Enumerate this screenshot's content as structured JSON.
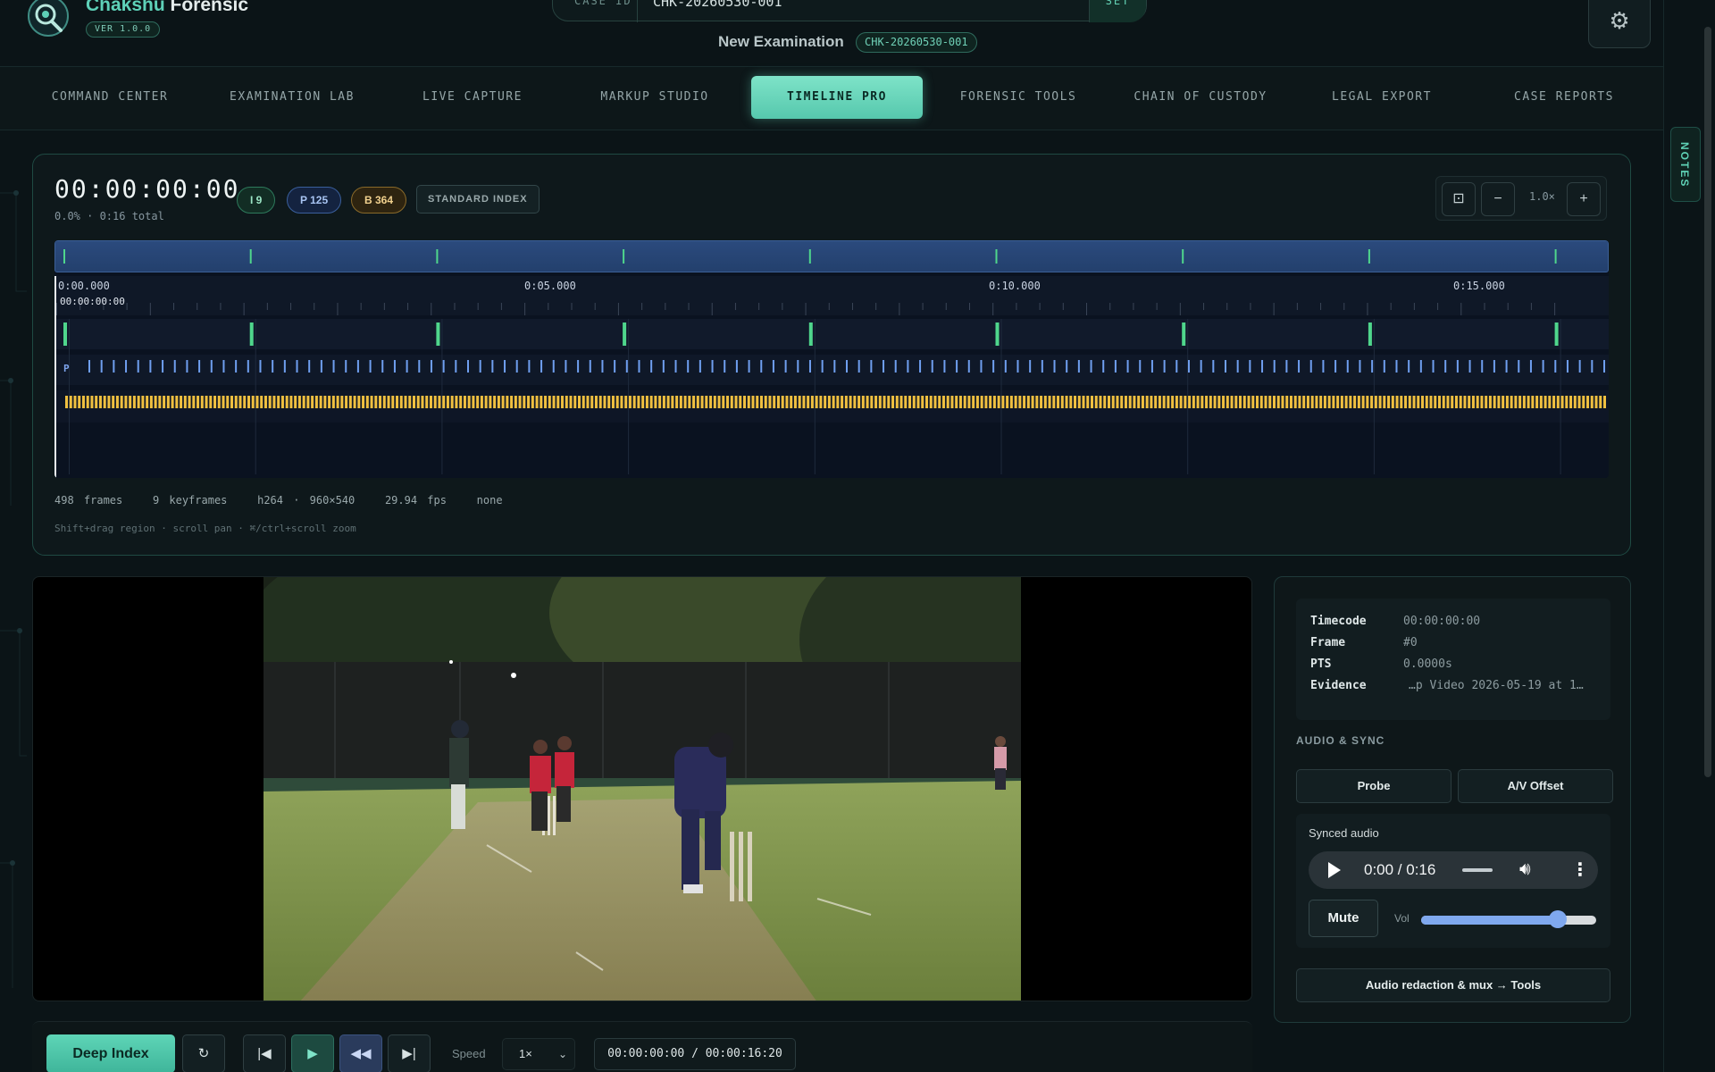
{
  "brand": {
    "name_part1": "Chakshu",
    "name_part2": "Forensic",
    "version": "VER 1.0.0"
  },
  "case": {
    "label": "CASE ID",
    "value": "CHK-20260530-001",
    "set_label": "SET"
  },
  "exam": {
    "title": "New Examination",
    "badge": "CHK-20260530-001"
  },
  "nav": {
    "items": [
      {
        "label": "COMMAND CENTER"
      },
      {
        "label": "EXAMINATION LAB"
      },
      {
        "label": "LIVE CAPTURE"
      },
      {
        "label": "MARKUP STUDIO"
      },
      {
        "label": "TIMELINE PRO",
        "active": true
      },
      {
        "label": "FORENSIC TOOLS"
      },
      {
        "label": "CHAIN OF CUSTODY"
      },
      {
        "label": "LEGAL EXPORT"
      },
      {
        "label": "CASE REPORTS"
      }
    ]
  },
  "notes_label": "NOTES",
  "timeline": {
    "timecode": "00:00:00:00",
    "subtitle": "0.0% · 0:16 total",
    "pill_i": "I 9",
    "pill_p": "P 125",
    "pill_b": "B 364",
    "index_mode": "STANDARD INDEX",
    "zoom_value": "1.0×",
    "ruler_labels": [
      "0:00.000",
      "0:05.000",
      "0:10.000",
      "0:15.000"
    ],
    "playhead_tc": "00:00:00:00",
    "track_p_label": "P",
    "info": {
      "frames": "498 frames",
      "keyframes": "9 keyframes",
      "codec": "h264 · 960×540",
      "fps": "29.94 fps",
      "rotation": "none"
    },
    "hint": "Shift+drag region · scroll pan · ⌘/ctrl+scroll zoom"
  },
  "frame_info": {
    "timecode_label": "Timecode",
    "timecode_value": "00:00:00:00",
    "frame_label": "Frame",
    "frame_value": "#0",
    "pts_label": "PTS",
    "pts_value": "0.0000s",
    "evidence_label": "Evidence",
    "evidence_value": "…p Video 2026-05-19 at 1…"
  },
  "audio": {
    "section_title": "AUDIO & SYNC",
    "probe_label": "Probe",
    "offset_label": "A/V Offset",
    "synced_label": "Synced audio",
    "player_time": "0:00 / 0:16",
    "mute_label": "Mute",
    "vol_label": "Vol",
    "volume": 0.78,
    "redaction_label": "Audio redaction & mux → Tools"
  },
  "transport": {
    "deep_index_label": "Deep Index",
    "speed_label": "Speed",
    "speed_value": "1×",
    "timecode_display": "00:00:00:00 / 00:00:16:20"
  },
  "icons": {
    "gear": "gear-icon",
    "logo": "eye-magnifier-logo",
    "refresh": "refresh-icon",
    "first": "skip-first-icon",
    "play": "play-icon",
    "rewind": "rewind-icon",
    "last": "skip-last-icon"
  },
  "colors": {
    "accent": "#5ed1b8",
    "i_frame": "#4fd68c",
    "p_frame": "#6f9ff0",
    "b_frame": "#f0c040"
  }
}
